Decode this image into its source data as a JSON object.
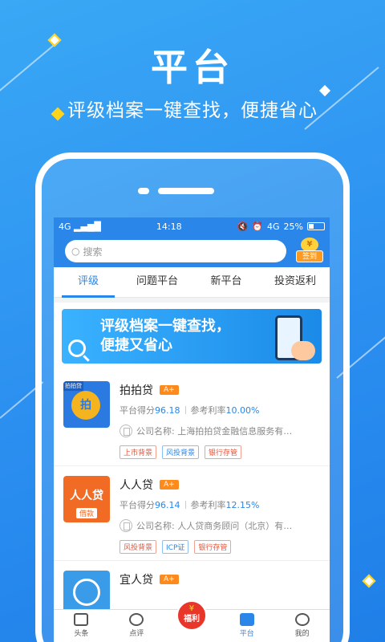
{
  "headline": "平台",
  "subline": "评级档案一键查找，便捷省心",
  "status": {
    "signal": "4G",
    "time": "14:18",
    "network": "4G",
    "battery": "25%"
  },
  "search": {
    "placeholder": "搜索",
    "signin_coin": "¥",
    "signin_label": "签到"
  },
  "tabs": [
    {
      "label": "评级",
      "active": true
    },
    {
      "label": "问题平台",
      "active": false
    },
    {
      "label": "新平台",
      "active": false
    },
    {
      "label": "投资返利",
      "active": false
    }
  ],
  "banner": {
    "line1": "评级档案一键查找，",
    "line2": "便捷又省心"
  },
  "platforms": [
    {
      "name": "拍拍贷",
      "grade": "A+",
      "score_label": "平台得分",
      "score": "96.18",
      "rate_label": "参考利率",
      "rate": "10.00%",
      "company": "公司名称: 上海拍拍贷金融信息服务有…",
      "tags": [
        "上市背景",
        "风投背景",
        "银行存管"
      ],
      "logo_text": "拍",
      "logo_corner": "拍拍贷"
    },
    {
      "name": "人人贷",
      "grade": "A+",
      "score_label": "平台得分",
      "score": "96.14",
      "rate_label": "参考利率",
      "rate": "12.15%",
      "company": "公司名称: 人人贷商务顾问（北京）有…",
      "tags": [
        "风投背景",
        "ICP证",
        "银行存管"
      ],
      "logo_text": "人人贷",
      "logo_sub": "借款"
    },
    {
      "name": "宜人贷",
      "grade": "A+"
    }
  ],
  "tabbar": [
    {
      "label": "头条"
    },
    {
      "label": "点评"
    },
    {
      "label": "福利",
      "coin": "¥"
    },
    {
      "label": "平台",
      "active": true
    },
    {
      "label": "我的"
    }
  ],
  "colors": {
    "primary": "#2a86e8",
    "accent": "#ff8a1c",
    "red": "#e8362b"
  }
}
